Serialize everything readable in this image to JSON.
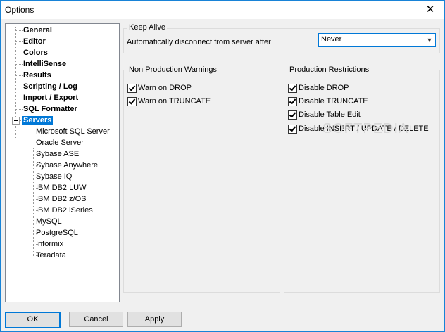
{
  "window": {
    "title": "Options",
    "close_glyph": "✕"
  },
  "tree": {
    "top_items": [
      "General",
      "Editor",
      "Colors",
      "IntelliSense",
      "Results",
      "Scripting / Log",
      "Import / Export",
      "SQL Formatter"
    ],
    "selected": "Servers",
    "children": [
      "Microsoft SQL Server",
      "Oracle Server",
      "Sybase ASE",
      "Sybase Anywhere",
      "Sybase IQ",
      "IBM DB2 LUW",
      "IBM DB2 z/OS",
      "IBM DB2 iSeries",
      "MySQL",
      "PostgreSQL",
      "Informix",
      "Teradata"
    ]
  },
  "keep_alive": {
    "title": "Keep Alive",
    "label": "Automatically disconnect from server after",
    "value": "Never"
  },
  "non_production": {
    "title": "Non Production Warnings",
    "items": [
      {
        "label": "Warn on DROP",
        "checked": true
      },
      {
        "label": "Warn on TRUNCATE",
        "checked": true
      }
    ]
  },
  "production": {
    "title": "Production Restrictions",
    "items": [
      {
        "label": "Disable DROP",
        "checked": true
      },
      {
        "label": "Disable TRUNCATE",
        "checked": true
      },
      {
        "label": "Disable Table Edit",
        "checked": true
      },
      {
        "label": "Disable INSERT / UPDATE / DELETE",
        "checked": true
      }
    ]
  },
  "watermark": "SOFTPEDIA",
  "buttons": {
    "ok": "OK",
    "cancel": "Cancel",
    "apply": "Apply"
  }
}
